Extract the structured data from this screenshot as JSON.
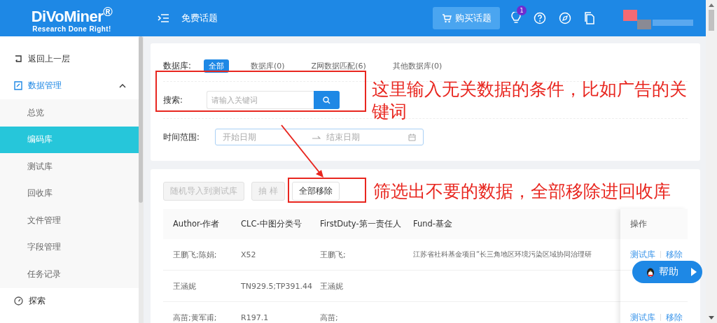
{
  "header": {
    "logo": "DiVoMiner$^{®}$",
    "tagline": "Research Done Right!",
    "title": "免费话题",
    "buy_button": "购买话题",
    "notification_count": "1"
  },
  "sidebar": {
    "items": [
      {
        "kind": "link",
        "label": "返回上一层",
        "selected": false
      },
      {
        "kind": "group",
        "label": "数据管理",
        "selected": false,
        "expanded": true,
        "children": [
          {
            "label": "总览",
            "selected": false
          },
          {
            "label": "编码库",
            "selected": true
          },
          {
            "label": "测试库",
            "selected": false
          },
          {
            "label": "回收库",
            "selected": false
          },
          {
            "label": "文件管理",
            "selected": false
          },
          {
            "label": "字段管理",
            "selected": false
          },
          {
            "label": "任务记录",
            "selected": false
          }
        ]
      },
      {
        "kind": "explore",
        "label": "探索",
        "selected": false
      }
    ]
  },
  "filters": {
    "label": "数据库:",
    "tabs": [
      {
        "label": "全部",
        "selected": true
      },
      {
        "label": "数据库(0)",
        "selected": false
      },
      {
        "label": "Z网数据匹配(6)",
        "selected": false
      },
      {
        "label": "其他数据库(0)",
        "selected": false
      }
    ]
  },
  "search": {
    "label": "搜索:",
    "placeholder": "请输入关键词"
  },
  "time_range": {
    "label": "时间范围:",
    "start_placeholder": "开始日期",
    "end_placeholder": "结束日期"
  },
  "annotations": [
    {
      "text": "这里输入无关数据的条件，比如广告的关键词"
    },
    {
      "text": "筛选出不要的数据，全部移除进回收库"
    }
  ],
  "actions": [
    {
      "label": "随机导入到测试库",
      "disabled": true
    },
    {
      "label": "抽 样",
      "disabled": true
    },
    {
      "label": "全部移除",
      "disabled": false
    }
  ],
  "table": {
    "columns": [
      "Author-作者",
      "CLC-中图分类号",
      "FirstDuty-第一责任人",
      "Fund-基金"
    ],
    "action_column": "操作",
    "rows": [
      {
        "cells": [
          "王鹏飞;陈娟;",
          "X52",
          "王鹏飞;",
          "江苏省社科基金项目“长三角地区环境污染区域协同治理研"
        ],
        "actions": [
          "测试库",
          "移除"
        ]
      },
      {
        "cells": [
          "王涵妮",
          "TN929.5;TP391.44",
          "王涵妮",
          ""
        ],
        "actions": []
      },
      {
        "cells": [
          "高苗;黄军甫;",
          "R197.1",
          "高苗;",
          ""
        ],
        "actions": [
          "测试库",
          "移除"
        ]
      }
    ]
  },
  "help_button": {
    "label": "帮助"
  }
}
